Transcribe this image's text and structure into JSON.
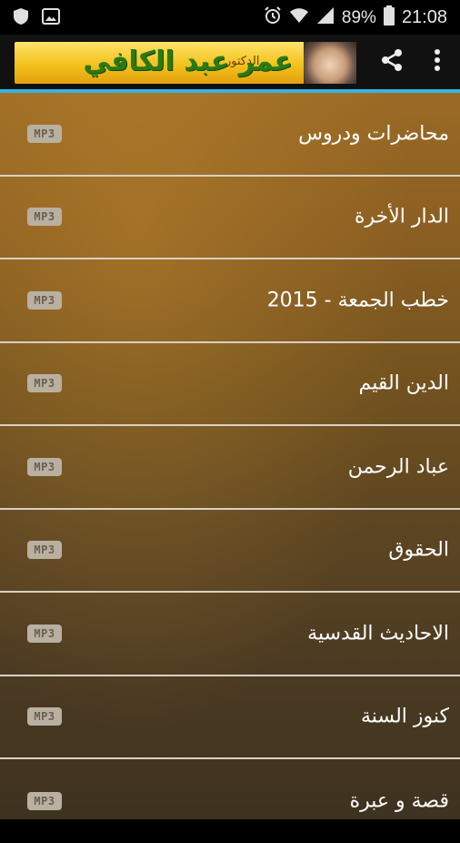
{
  "status_bar": {
    "battery": "89%",
    "time": "21:08",
    "icons": [
      "shield-icon",
      "image-icon",
      "alarm-icon",
      "wifi-icon",
      "signal-icon",
      "battery-icon"
    ]
  },
  "app_bar": {
    "banner_title": "عمر عبد الكافي",
    "banner_subtitle": "الدكتور",
    "actions": [
      "share-icon",
      "overflow-menu-icon"
    ],
    "accent_color": "#33b5e5"
  },
  "list": {
    "badge": "MP3",
    "items": [
      {
        "label": "محاضرات ودروس"
      },
      {
        "label": "الدار الأخرة"
      },
      {
        "label": "خطب الجمعة - 2015"
      },
      {
        "label": "الدين القيم"
      },
      {
        "label": "عباد الرحمن"
      },
      {
        "label": "الحقوق"
      },
      {
        "label": "الاحاديث القدسية"
      },
      {
        "label": "كنوز السنة"
      },
      {
        "label": "قصة و عبرة"
      }
    ]
  }
}
